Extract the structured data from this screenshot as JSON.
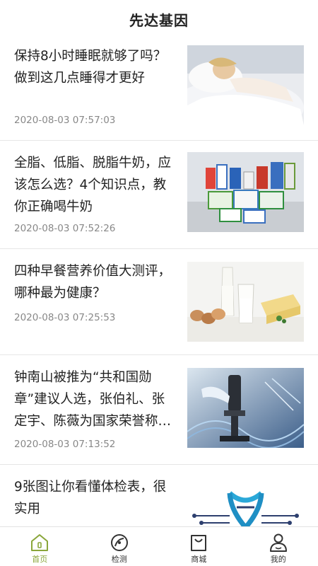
{
  "header": {
    "title": "先达基因"
  },
  "articles": [
    {
      "title": "保持8小时睡眠就够了吗？做到这几点睡得才更好",
      "time": "2020-08-03 07:57:03",
      "image": "sleeping-woman-photo"
    },
    {
      "title": "全脂、低脂、脱脂牛奶，应该怎么选？4个知识点，教你正确喝牛奶",
      "time": "2020-08-03 07:52:26",
      "image": "milk-cartons-photo"
    },
    {
      "title": "四种早餐营养价值大测评，哪种最为健康？",
      "time": "2020-08-03 07:25:53",
      "image": "breakfast-milk-eggs-photo"
    },
    {
      "title": "钟南山被推为“共和国勋章”建议人选，张伯礼、张定宇、陈薇为国家荣誉称号建议人选",
      "time": "2020-08-03 07:13:52",
      "image": "microscope-dna-photo"
    },
    {
      "title": "9张图让你看懂体检表，很实用",
      "time": "",
      "image": "dna-circuit-illustration"
    }
  ],
  "tabbar": {
    "items": [
      {
        "label": "首页",
        "icon": "home-icon",
        "active": true
      },
      {
        "label": "检测",
        "icon": "test-icon",
        "active": false
      },
      {
        "label": "商城",
        "icon": "shop-bag-icon",
        "active": false
      },
      {
        "label": "我的",
        "icon": "profile-icon",
        "active": false
      }
    ],
    "active_color": "#8aa63a"
  }
}
